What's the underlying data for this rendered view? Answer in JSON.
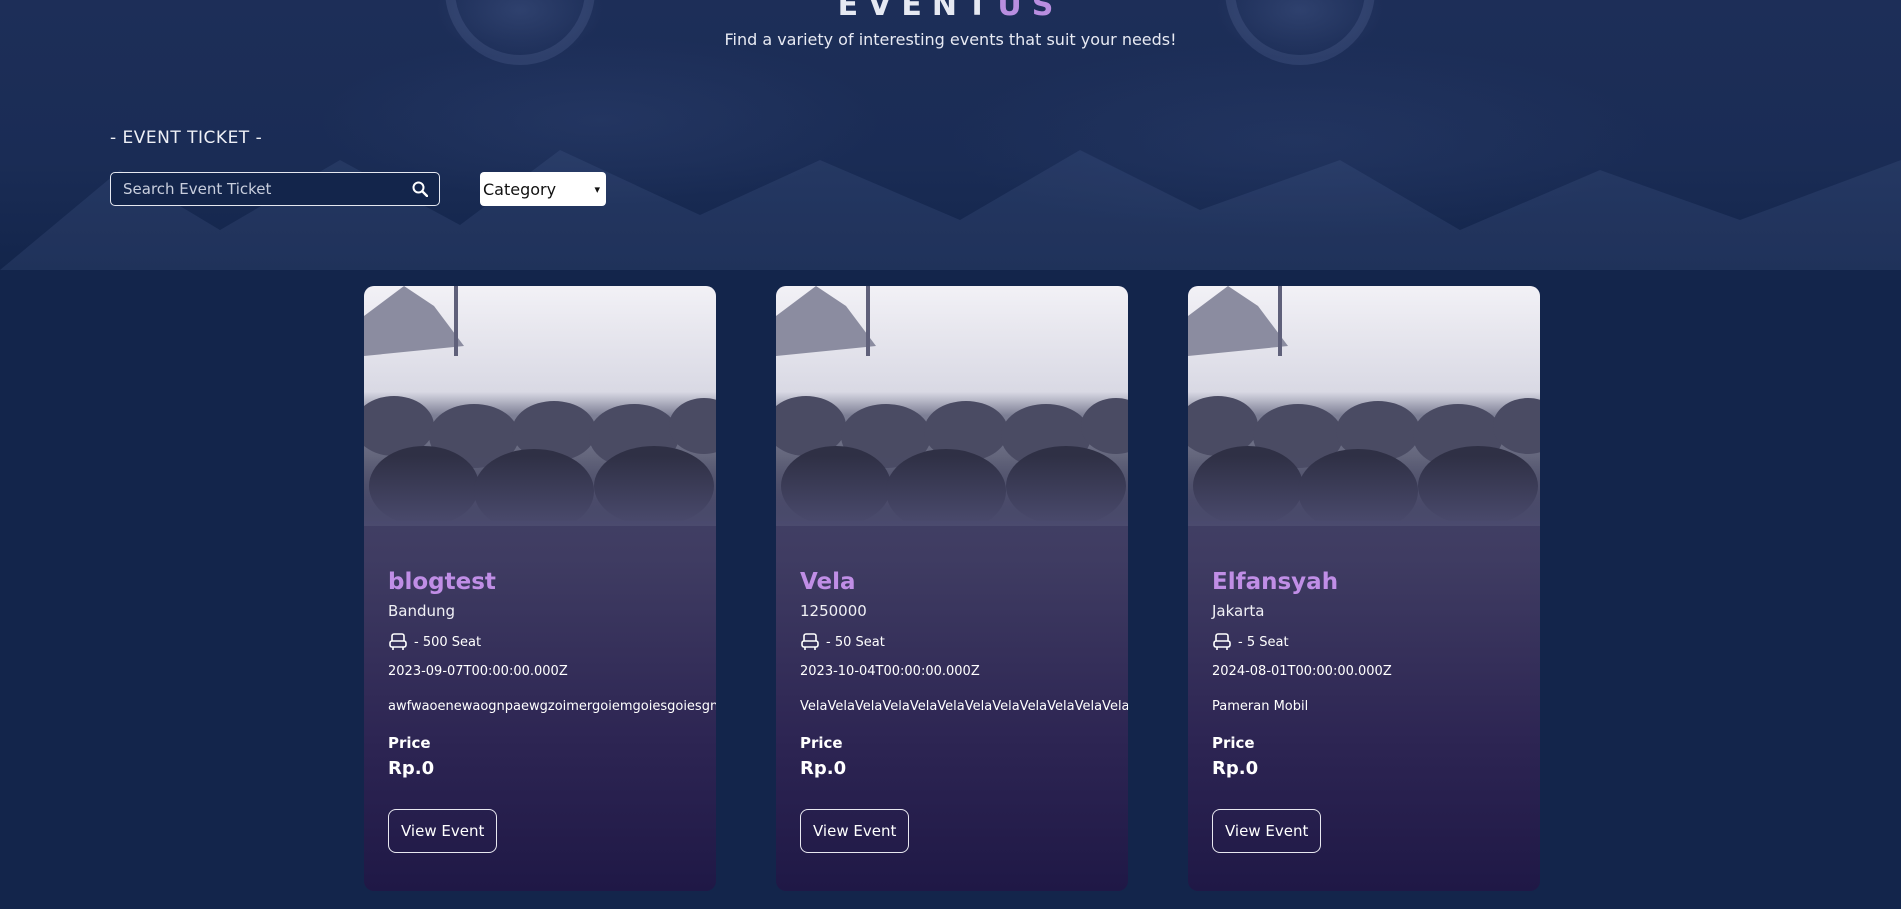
{
  "header": {
    "brand_main": "EVENT",
    "brand_accent": "US",
    "tagline": "Find a variety of interesting events that suit your needs!"
  },
  "section": {
    "title": "- EVENT TICKET -"
  },
  "search": {
    "placeholder": "Search Event Ticket",
    "icon": "search-icon"
  },
  "category": {
    "selected": "Category"
  },
  "cards": [
    {
      "title": "blogtest",
      "location": "Bandung",
      "seats": "- 500 Seat",
      "date": "2023-09-07T00:00:00.000Z",
      "description": "awfwaoenewaognpaewgzoimergoiemgoiesgoiesgnoi",
      "price_label": "Price",
      "price": "Rp.0",
      "button": "View Event"
    },
    {
      "title": "Vela",
      "location": "1250000",
      "seats": "- 50 Seat",
      "date": "2023-10-04T00:00:00.000Z",
      "description": "VelaVelaVelaVelaVelaVelaVelaVelaVelaVelaVelaVela",
      "price_label": "Price",
      "price": "Rp.0",
      "button": "View Event"
    },
    {
      "title": "Elfansyah",
      "location": "Jakarta",
      "seats": "- 5 Seat",
      "date": "2024-08-01T00:00:00.000Z",
      "description": "Pameran Mobil",
      "price_label": "Price",
      "price": "Rp.0",
      "button": "View Event"
    }
  ],
  "colors": {
    "background": "#13254b",
    "accent": "#c08ee6",
    "card_gradient_top": "#4b4b6e",
    "card_gradient_bottom": "#1f1846"
  }
}
